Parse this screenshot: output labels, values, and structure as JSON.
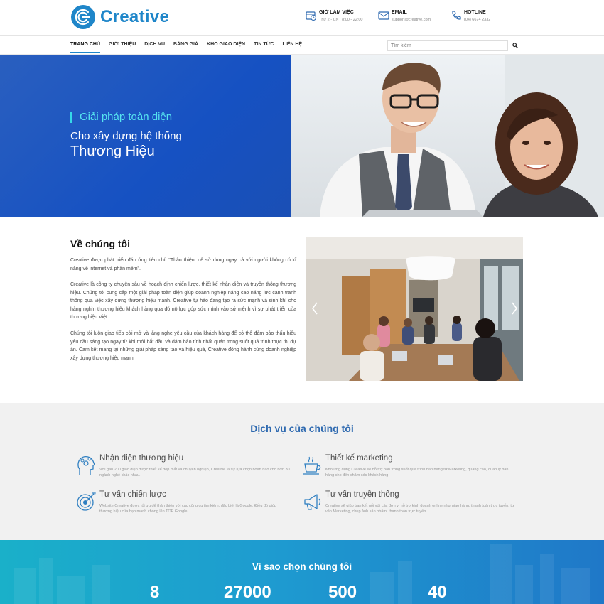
{
  "brand": {
    "name": "Creative",
    "color": "#1f86c9"
  },
  "header": {
    "contacts": [
      {
        "icon": "clock-icon",
        "title": "GIỜ LÀM VIỆC",
        "value": "Thứ 2 - CN : 8:00 - 22:00"
      },
      {
        "icon": "envelope-icon",
        "title": "EMAIL",
        "value": "support@creative.com"
      },
      {
        "icon": "phone-icon",
        "title": "HOTLINE",
        "value": "(04) 6674 2332"
      }
    ]
  },
  "nav": {
    "items": [
      "TRANG CHỦ",
      "GIỚI THIỆU",
      "DỊCH VỤ",
      "BẢNG GIÁ",
      "KHO GIAO DIỆN",
      "TIN TỨC",
      "LIÊN HỆ"
    ],
    "active": "TRANG CHỦ",
    "search_placeholder": "Tìm kiếm"
  },
  "hero": {
    "tag": "Giải pháp toàn diện",
    "line1": "Cho xây dựng hệ thống",
    "line2": "Thương Hiệu",
    "colors": {
      "left_bg": "#1651c2",
      "tag": "#56e4f0"
    }
  },
  "about": {
    "title": "Về chúng tôi",
    "paragraphs": [
      "Creative được phát triển đáp ứng tiêu chí: \"Thân thiện, dễ sử dụng ngay cả với người không có kĩ năng về internet và phần mềm\".",
      "Creative là công ty chuyên sâu về hoạch định chiến lược, thiết kế nhận diện và truyền thông thương hiệu. Chúng tôi cung cấp một giải pháp toàn diện giúp doanh nghiệp nâng cao năng lực cạnh tranh thông qua việc xây dựng thương hiệu mạnh. Creative tự hào đang tạo ra sức mạnh và sinh khí cho hàng nghìn thương hiệu khách hàng qua đó nỗ lực góp sức mình vào sứ mệnh vì sự phát triển của thương hiệu Việt.",
      "Chúng tôi luôn giao tiếp cởi mở và lắng nghe yêu cầu của khách hàng để có thể đảm bảo thấu hiểu yêu cầu sáng tạo ngay từ khi mới bắt đầu và đảm bảo tính nhất quán trong suốt quá trình thực thi dự án. Cam kết mang lại những giải pháp sáng tạo và hiệu quả, Creative đồng hành cùng doanh nghiệp xây dựng thương hiệu mạnh."
    ]
  },
  "services": {
    "title": "Dịch vụ của chúng tôi",
    "items": [
      {
        "icon": "brain-gears-icon",
        "title": "Nhận diện thương hiệu",
        "desc": "Với gần 200 giao diện được thiết kế đẹp mắt và chuyên nghiệp, Creative là sự lựa chọn hoàn hảo cho hơn 30 ngành nghề khác nhau."
      },
      {
        "icon": "coffee-cup-icon",
        "title": "Thiết kế marketing",
        "desc": "Kho ứng dụng Creative sẽ hỗ trợ bạn trong suốt quá trình bán hàng từ Marketing, quảng cáo, quản lý bán hàng cho đến chăm sóc khách hàng"
      },
      {
        "icon": "target-icon",
        "title": "Tư vấn chiến lược",
        "desc": "Website Creative được tối ưu để thân thiện với các công cụ tìm kiếm, đặc biệt là Google. Điều đó giúp thương hiệu của bạn mạnh chóng lên TOP Google"
      },
      {
        "icon": "megaphone-icon",
        "title": "Tư vấn truyền thông",
        "desc": "Creative sẽ giúp bạn kết nối với các đơn vị hỗ trợ kinh doanh online như giao hàng, thanh toán trực tuyến, tư vấn Marketing, chụp ảnh sản phẩm, thanh toán trực tuyến"
      }
    ]
  },
  "why": {
    "title": "Vì sao chọn chúng tôi",
    "stats": [
      "8",
      "27000",
      "500",
      "40"
    ]
  }
}
